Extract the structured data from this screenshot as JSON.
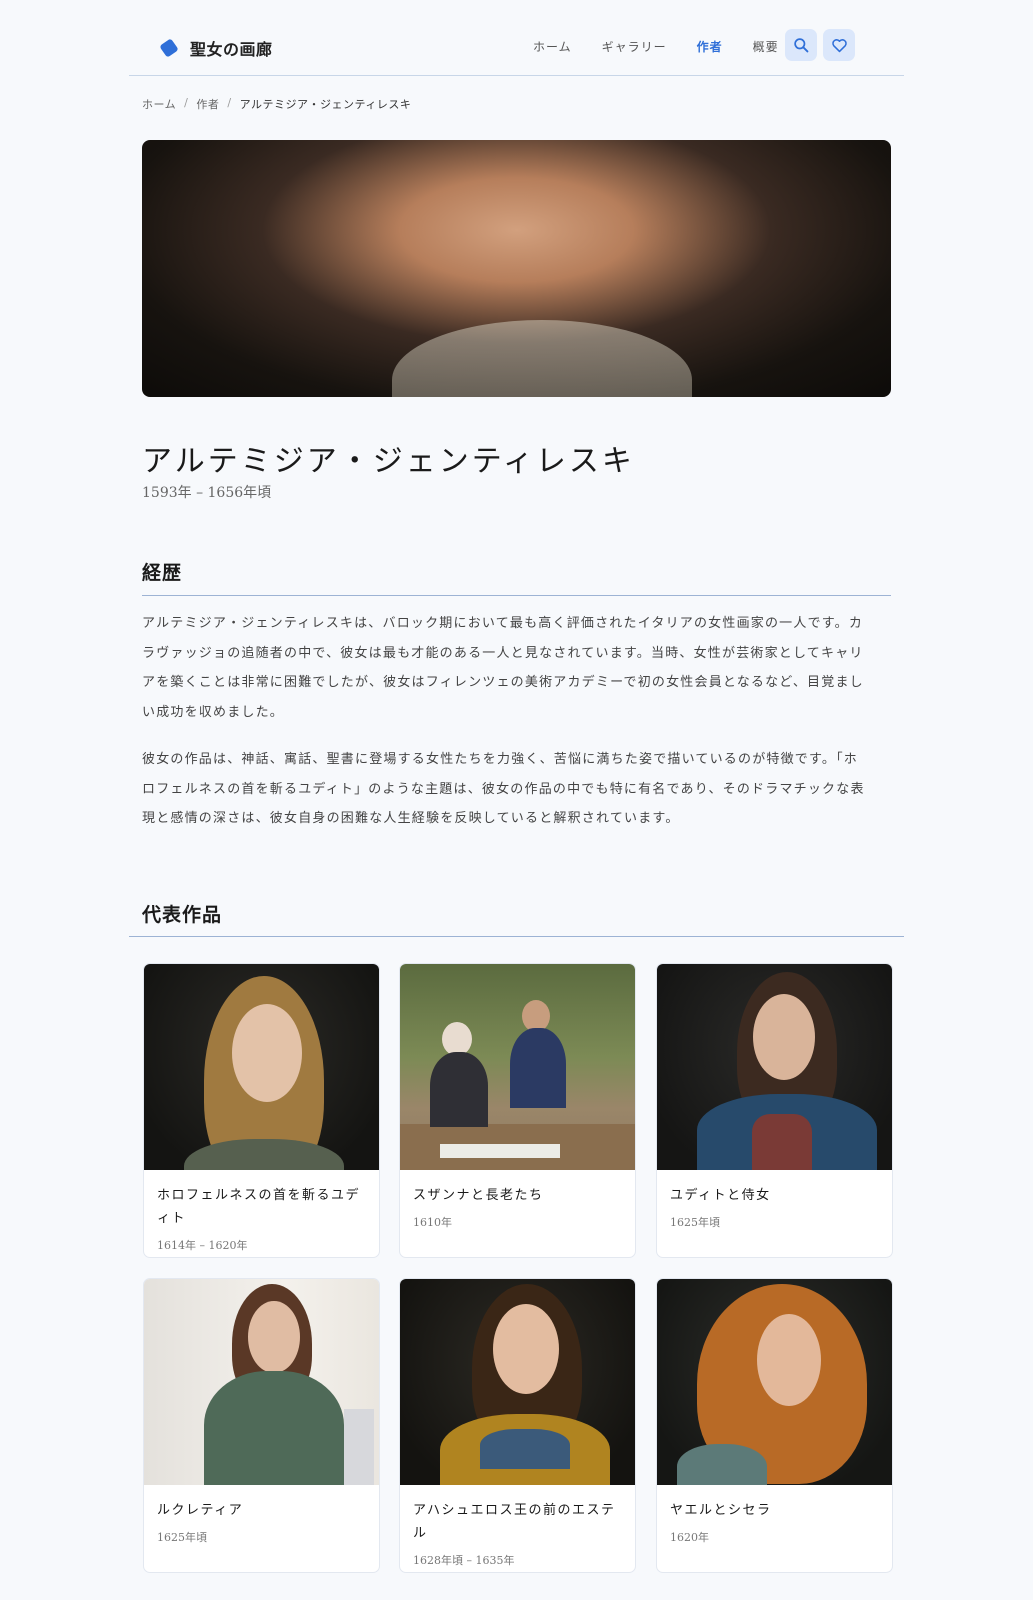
{
  "header": {
    "title": "聖女の画廊",
    "nav": [
      "ホーム",
      "ギャラリー",
      "作者",
      "概要"
    ],
    "active_nav": "作者",
    "search_icon": "search-icon",
    "favorite_icon": "heart-icon"
  },
  "breadcrumb": {
    "items": [
      "ホーム",
      "作者",
      "アルテミジア・ジェンティレスキ"
    ]
  },
  "artist": {
    "name": "アルテミジア・ジェンティレスキ",
    "dates": "1593年 – 1656年頃"
  },
  "bio": {
    "heading": "経歴",
    "paragraph1_line1": "アルテミジア・ジェンティレスキは、バロック期において最も高く評価されたイタリアの女性画家の一人です。カ",
    "paragraph1_line2": "ラヴァッジョの追随者の中で、彼女は最も才能のある一人と見なされています。当時、女性が芸術家としてキャリ",
    "paragraph1_line3": "アを築くことは非常に困難でしたが、彼女はフィレンツェの美術アカデミーで初の女性会員となるなど、目覚まし",
    "paragraph1_line4": "い成功を収めました。",
    "paragraph2_line1": "彼女の作品は、神話、寓話、聖書に登場する女性たちを力強く、苦悩に満ちた姿で描いているのが特徴です。「ホ",
    "paragraph2_line2": "ロフェルネスの首を斬るユディト」のような主題は、彼女の作品の中でも特に有名であり、そのドラマチックな表",
    "paragraph2_line3": "現と感情の深さは、彼女自身の困難な人生経験を反映していると解釈されています。"
  },
  "works": {
    "heading": "代表作品",
    "items": [
      {
        "title_line1": "ホロフェルネスの首を斬るユデ",
        "title_line2": "ィト",
        "date": "1614年 – 1620年"
      },
      {
        "title_line1": "スザンナと長老たち",
        "title_line2": "",
        "date": "1610年"
      },
      {
        "title_line1": "ユディトと侍女",
        "title_line2": "",
        "date": "1625年頃"
      },
      {
        "title_line1": "ルクレティア",
        "title_line2": "",
        "date": "1625年頃"
      },
      {
        "title_line1": "アハシュエロス王の前のエステ",
        "title_line2": "ル",
        "date": "1628年頃 – 1635年"
      },
      {
        "title_line1": "ヤエルとシセラ",
        "title_line2": "",
        "date": "1620年"
      }
    ]
  },
  "colors": {
    "accent": "#2f6fd8",
    "background": "#f7f9fc",
    "rule": "#9db3d4"
  }
}
